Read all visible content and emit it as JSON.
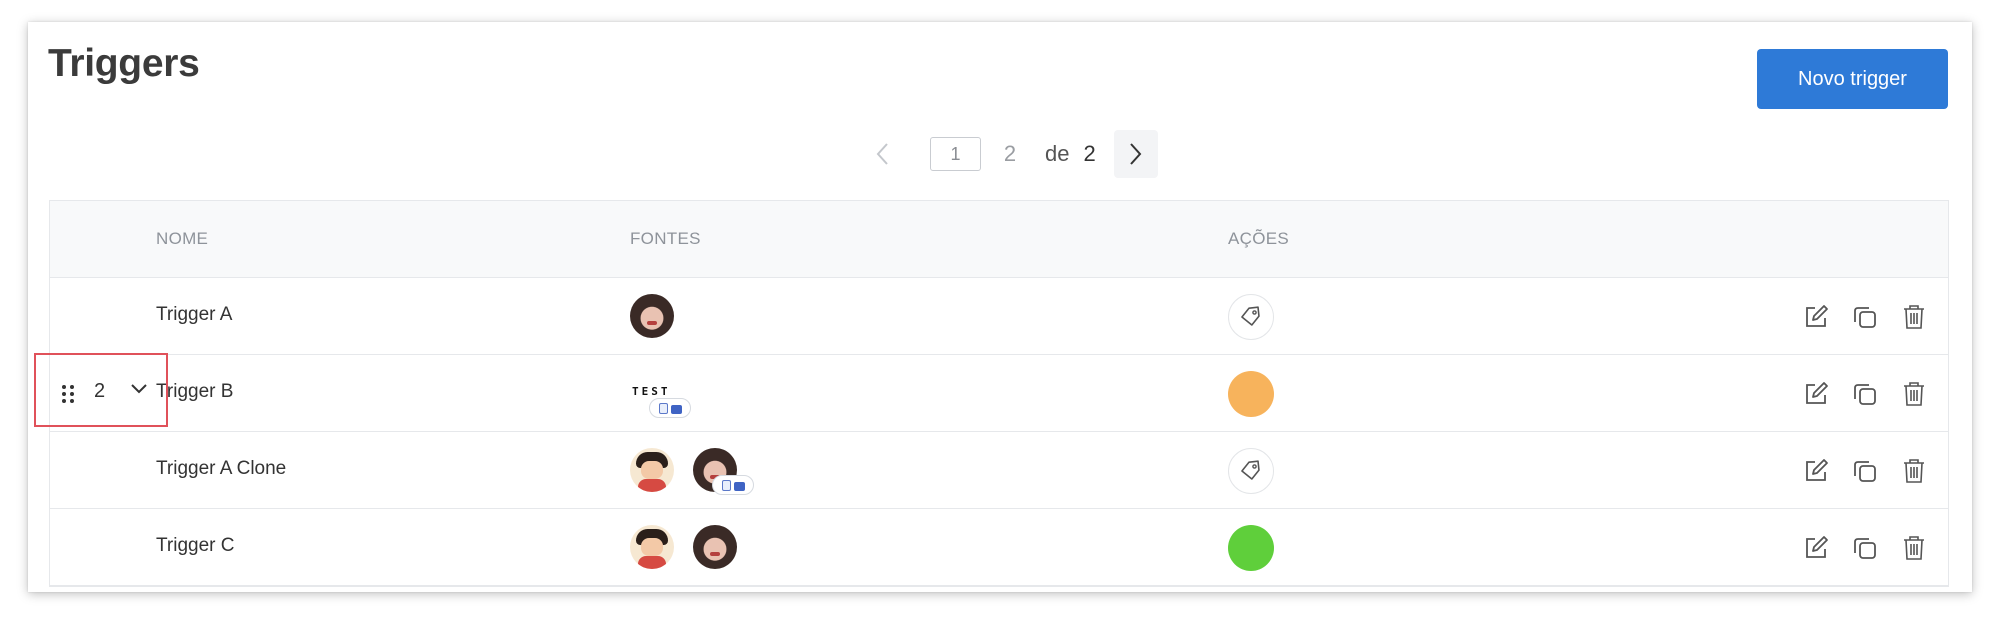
{
  "page": {
    "title": "Triggers",
    "new_button": "Novo trigger"
  },
  "pagination": {
    "current": "1",
    "other_page": "2",
    "of_label": "de",
    "total": "2"
  },
  "table": {
    "headers": {
      "name": "NOME",
      "sources": "FONTES",
      "actions": "AÇÕES"
    },
    "rows": [
      {
        "name": "Trigger A",
        "sources": [
          "woman-avatar"
        ],
        "action": "tag-icon",
        "action_color": ""
      },
      {
        "name": "Trigger B",
        "sources": [
          "test-logo"
        ],
        "source_logo_text": "TEST",
        "action": "color-dot",
        "action_color": "#f7b35c"
      },
      {
        "name": "Trigger A Clone",
        "sources": [
          "cartoon-avatar",
          "woman-avatar"
        ],
        "action": "tag-icon",
        "action_color": ""
      },
      {
        "name": "Trigger C",
        "sources": [
          "cartoon-avatar",
          "woman-avatar"
        ],
        "action": "color-dot",
        "action_color": "#5fcf3b"
      }
    ],
    "row_action_icons": [
      "edit-icon",
      "duplicate-icon",
      "trash-icon"
    ]
  },
  "drag_row": {
    "index": "2"
  },
  "colors": {
    "primary": "#2e7ad7",
    "highlight_border": "#e0515a",
    "orange": "#f7b35c",
    "green": "#5fcf3b"
  }
}
